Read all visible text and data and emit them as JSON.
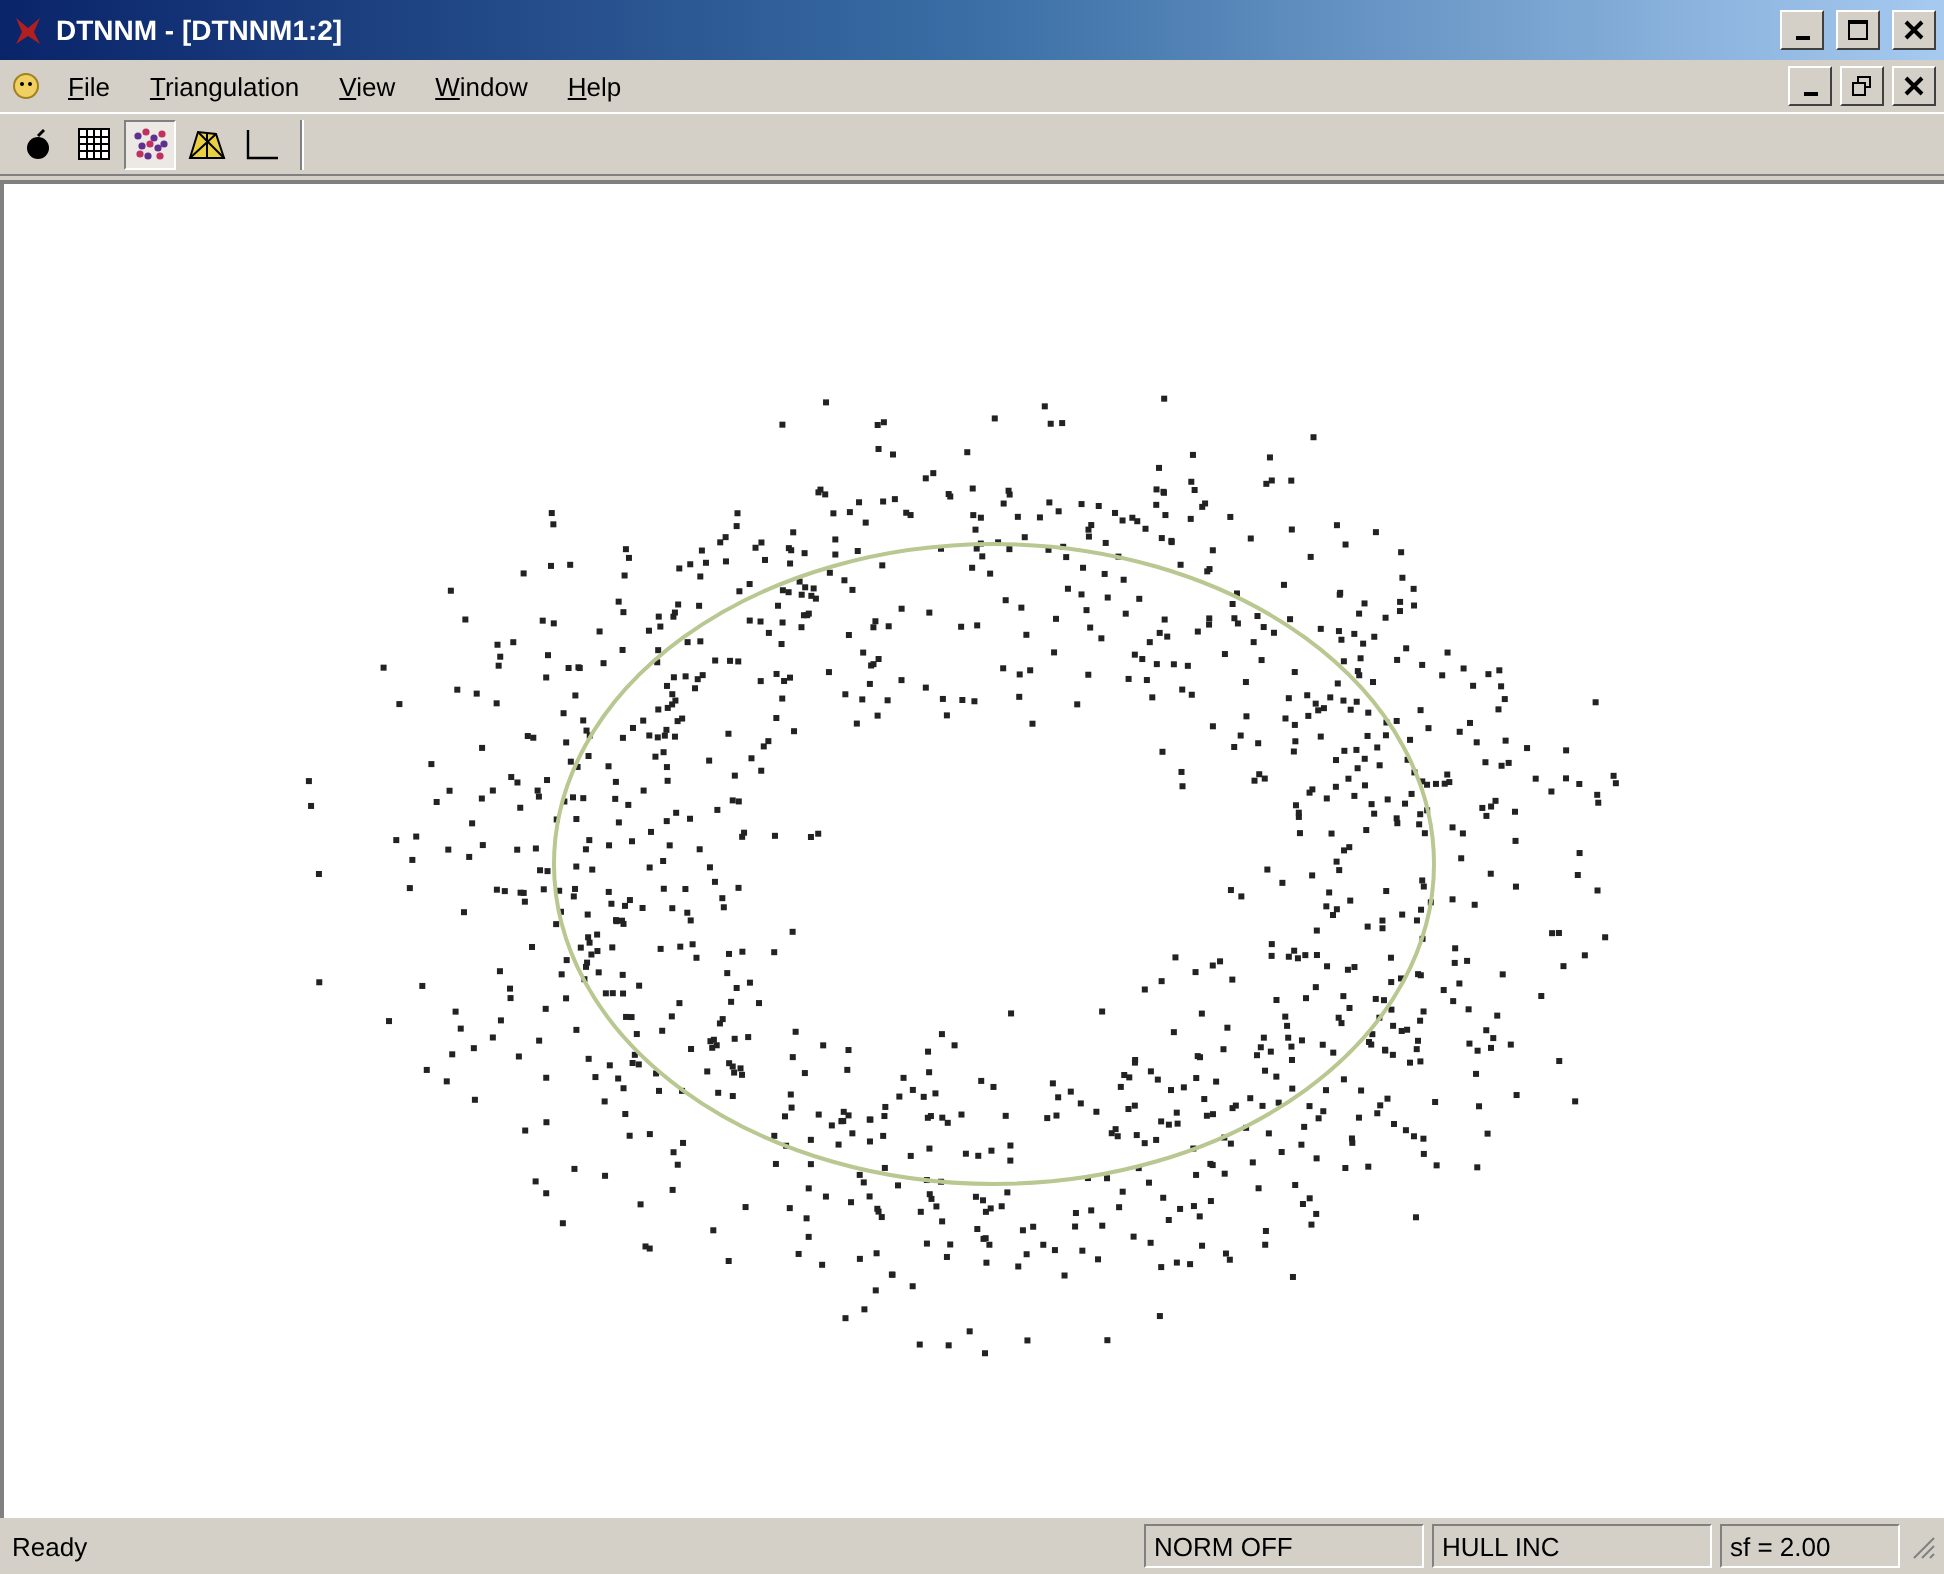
{
  "window": {
    "title": "DTNNM - [DTNNM1:2]"
  },
  "menu": [
    "File",
    "Triangulation",
    "View",
    "Window",
    "Help"
  ],
  "toolbar": [
    {
      "kind": "bomb",
      "selected": false
    },
    {
      "kind": "grid",
      "selected": false
    },
    {
      "kind": "points",
      "selected": true
    },
    {
      "kind": "mesh",
      "selected": false
    },
    {
      "kind": "axes",
      "selected": false
    }
  ],
  "status_bar": {
    "message": "Ready",
    "panels": [
      "NORM OFF",
      "HULL INC",
      "sf = 2.00"
    ]
  }
}
